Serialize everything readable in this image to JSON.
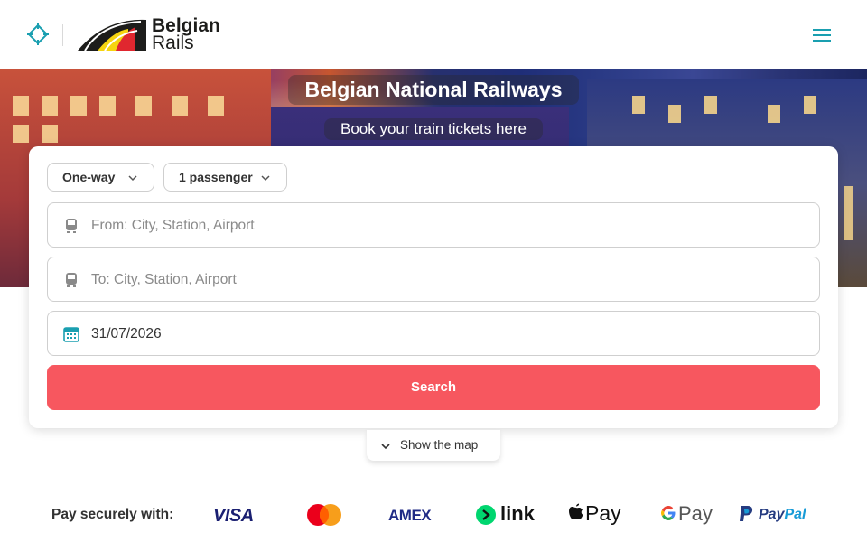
{
  "header": {
    "brand_line1": "Belgian",
    "brand_line2": "Rails",
    "menu_icon": "hamburger-menu-icon"
  },
  "hero": {
    "title": "Belgian National Railways",
    "subtitle": "Book your train tickets here"
  },
  "search_form": {
    "trip_type": "One-way",
    "passengers": "1 passenger",
    "from_placeholder": "From: City, Station, Airport",
    "to_placeholder": "To: City, Station, Airport",
    "date_value": "31/07/2026",
    "search_label": "Search",
    "search_color": "#f7575f"
  },
  "map_toggle": {
    "label": "Show the map"
  },
  "payments": {
    "label": "Pay securely with:",
    "methods": {
      "visa": "VISA",
      "mastercard": "mastercard-logo",
      "amex": "AMEX",
      "link": "link",
      "apple_pay": "Pay",
      "google_pay": "Pay",
      "paypal_a": "Pay",
      "paypal_b": "Pal"
    }
  }
}
